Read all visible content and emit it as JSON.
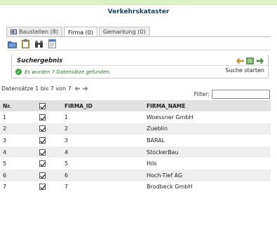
{
  "app": {
    "title": "Verkehrskataster"
  },
  "tabs": [
    {
      "label": "Baustellen (8)",
      "icon": "window-icon",
      "active": false
    },
    {
      "label": "Firma (0)",
      "active": true
    },
    {
      "label": "Gemarkung (0)",
      "active": false
    }
  ],
  "toolbar": {
    "icons": [
      "folder-icon",
      "clipboard-icon",
      "binoculars-icon",
      "document-icon"
    ]
  },
  "results": {
    "title": "Suchergebnis",
    "status": "Es wurden 7 Datensätze gefunden.",
    "search_button": "Suche starten",
    "icons": [
      "back-arrow-icon",
      "list-icon",
      "forward-arrow-icon"
    ]
  },
  "pager": {
    "info": "Datensätze 1 bis 7 von 7"
  },
  "filter": {
    "label": "Filter:",
    "value": ""
  },
  "grid": {
    "headers": [
      "Nr.",
      "",
      "FIRMA_ID",
      "FIRMA_NAME"
    ],
    "rows": [
      {
        "nr": "1",
        "checked": true,
        "id": "1",
        "name": "Woessner GmbH"
      },
      {
        "nr": "2",
        "checked": true,
        "id": "2",
        "name": "Zueblin"
      },
      {
        "nr": "3",
        "checked": true,
        "id": "3",
        "name": "BARAL"
      },
      {
        "nr": "4",
        "checked": true,
        "id": "4",
        "name": "StockerBau"
      },
      {
        "nr": "5",
        "checked": true,
        "id": "5",
        "name": "Hils"
      },
      {
        "nr": "6",
        "checked": true,
        "id": "6",
        "name": "Hoch-Tief AG"
      },
      {
        "nr": "7",
        "checked": true,
        "id": "7",
        "name": "Brodbeck GmbH"
      }
    ]
  },
  "colors": {
    "top_strip": "#dcf2c0",
    "title": "#1c3f63",
    "status": "#2b7a2b",
    "header_bg": "#e1e1e1",
    "alt_row": "#eeeeee"
  }
}
